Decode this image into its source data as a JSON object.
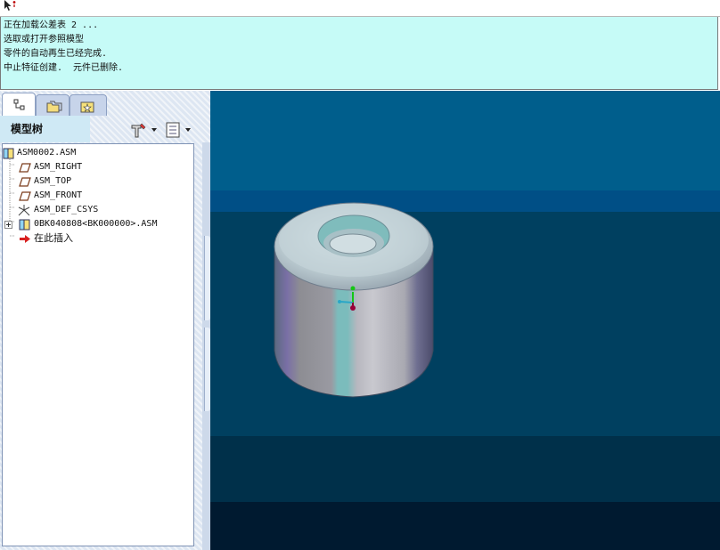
{
  "messages": [
    "正在加载公差表 2 ...",
    "选取或打开参照模型",
    "零件的自动再生已经完成.",
    "中止特征创建.  元件已删除."
  ],
  "left_panel": {
    "tabs": [
      {
        "icon": "model-tree-icon",
        "active": true
      },
      {
        "icon": "folder-browser-icon",
        "active": false
      },
      {
        "icon": "favorites-icon",
        "active": false
      }
    ],
    "title": "模型树",
    "tools": [
      "settings-icon",
      "show-icon"
    ]
  },
  "tree": [
    {
      "label": "ASM0002.ASM",
      "icon": "assembly-icon"
    },
    {
      "label": "ASM_RIGHT",
      "icon": "datum-plane-icon"
    },
    {
      "label": "ASM_TOP",
      "icon": "datum-plane-icon"
    },
    {
      "label": "ASM_FRONT",
      "icon": "datum-plane-icon"
    },
    {
      "label": "ASM_DEF_CSYS",
      "icon": "csys-icon"
    },
    {
      "label": "0BK040808<BK000000>.ASM",
      "icon": "assembly-icon"
    },
    {
      "label": "在此插入",
      "icon": "insert-here-icon"
    }
  ],
  "colors": {
    "message_bg": "#c6fbf7",
    "viewport_band_1": "#005e8c",
    "viewport_band_2": "#004f86",
    "viewport_band_3": "#004060",
    "viewport_band_4": "#00304a",
    "viewport_band_5": "#001a30",
    "model_body": "#a9a9b1",
    "model_accent": "#7fbcbc"
  }
}
